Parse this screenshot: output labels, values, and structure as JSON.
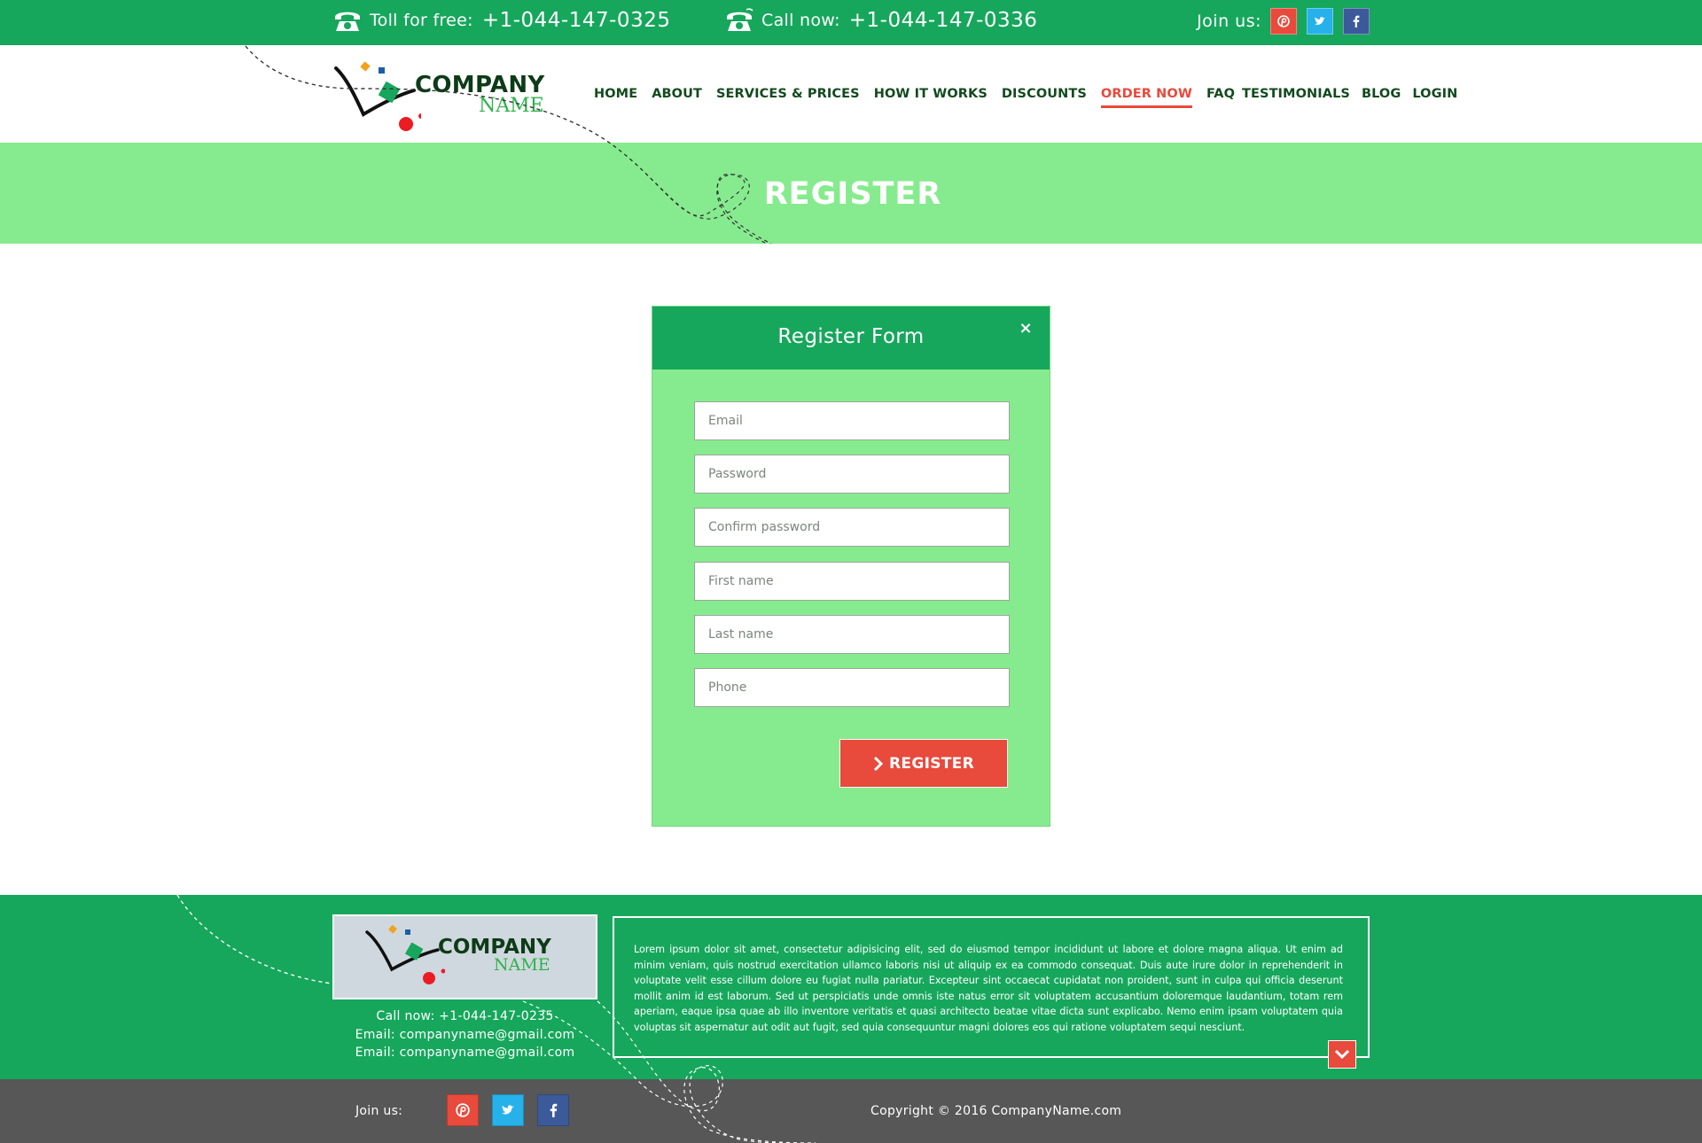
{
  "topbar": {
    "toll_label": "Toll for free:",
    "toll_number": "+1-044-147-0325",
    "call_label": "Call now:",
    "call_number": "+1-044-147-0336",
    "join_label": "Join us:",
    "social": [
      "pinterest-icon",
      "twitter-icon",
      "facebook-icon"
    ]
  },
  "logo": {
    "company": "COMPANY",
    "name": "NAME"
  },
  "nav": {
    "items": [
      "HOME",
      "ABOUT",
      "SERVICES & PRICES",
      "HOW IT WORKS",
      "DISCOUNTS",
      "ORDER NOW",
      "FAQ",
      "TESTIMONIALS",
      "BLOG",
      "LOGIN"
    ],
    "active": "ORDER NOW"
  },
  "banner": {
    "title": "REGISTER"
  },
  "form": {
    "title": "Register Form",
    "close": "×",
    "fields": {
      "email": "Email",
      "password": "Password",
      "confirm": "Confirm password",
      "first_name": "First name",
      "last_name": "Last name",
      "phone": "Phone"
    },
    "submit": "REGISTER"
  },
  "footer": {
    "call": "Call now: +1-044-147-0235",
    "email1": "Email: companyname@gmail.com",
    "email2": "Email: companyname@gmail.com",
    "about": "Lorem ipsum dolor sit amet, consectetur adipisicing elit, sed do eiusmod tempor incididunt ut labore et dolore magna aliqua. Ut enim ad minim veniam, quis nostrud exercitation ullamco laboris nisi ut aliquip ex ea commodo consequat. Duis aute irure dolor in reprehenderit in voluptate velit esse cillum dolore eu fugiat nulla pariatur. Excepteur sint occaecat cupidatat non proident, sunt in culpa qui officia deserunt mollit anim id est laborum. Sed ut perspiciatis unde omnis iste natus error sit voluptatem accusantium doloremque laudantium, totam rem aperiam, eaque ipsa quae ab illo inventore veritatis et quasi architecto beatae vitae dicta sunt explicabo. Nemo enim ipsam voluptatem quia voluptas sit aspernatur aut odit aut fugit, sed quia consequuntur magni dolores eos qui ratione voluptatem sequi nesciunt.",
    "join_label": "Join us:",
    "copyright": "Copyright © 2016 CompanyName.com"
  },
  "colors": {
    "primary_green": "#16a75c",
    "light_green": "#86eb8e",
    "accent_red": "#e84a3c",
    "bottom_bar": "#575757"
  }
}
